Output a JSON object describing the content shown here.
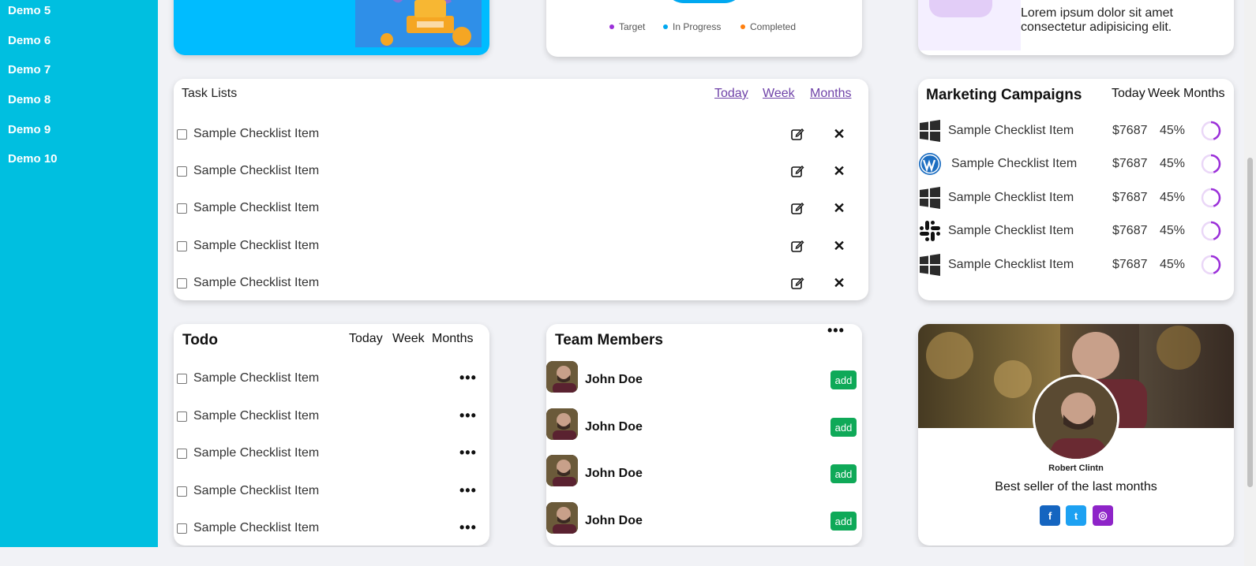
{
  "sidebar": {
    "items": [
      {
        "label": "Demo 5"
      },
      {
        "label": "Demo 6"
      },
      {
        "label": "Demo 7"
      },
      {
        "label": "Demo 8"
      },
      {
        "label": "Demo 9"
      },
      {
        "label": "Demo 10"
      }
    ]
  },
  "status_chart": {
    "legend": [
      "Target",
      "In Progress",
      "Completed"
    ],
    "colors": [
      "#9b30d9",
      "#00a8f0",
      "#ff7f0e"
    ]
  },
  "info_card": {
    "text": "Lorem ipsum dolor sit amet consectetur adipisicing elit."
  },
  "task_lists": {
    "title": "Task Lists",
    "tabs": [
      "Today",
      "Week",
      "Months"
    ],
    "items": [
      {
        "label": "Sample Checklist Item"
      },
      {
        "label": "Sample Checklist Item"
      },
      {
        "label": "Sample Checklist Item"
      },
      {
        "label": "Sample Checklist Item"
      },
      {
        "label": "Sample Checklist Item"
      }
    ],
    "close_glyph": "✕"
  },
  "marketing": {
    "title": "Marketing Campaigns",
    "tabs": [
      "Today",
      "Week",
      "Months"
    ],
    "rows": [
      {
        "logo": "windows-icon",
        "label": "Sample Checklist Item",
        "price": "$7687",
        "percent": "45%",
        "progress": 0.45
      },
      {
        "logo": "wordpress-icon",
        "label": "Sample Checklist Item",
        "price": "$7687",
        "percent": "45%",
        "progress": 0.45
      },
      {
        "logo": "windows-icon",
        "label": "Sample Checklist Item",
        "price": "$7687",
        "percent": "45%",
        "progress": 0.45
      },
      {
        "logo": "slack-icon",
        "label": "Sample Checklist Item",
        "price": "$7687",
        "percent": "45%",
        "progress": 0.45
      },
      {
        "logo": "windows-icon",
        "label": "Sample Checklist Item",
        "price": "$7687",
        "percent": "45%",
        "progress": 0.45
      }
    ],
    "ring_color": "#9b30d9"
  },
  "todo": {
    "title": "Todo",
    "tabs": [
      "Today",
      "Week",
      "Months"
    ],
    "items": [
      {
        "label": "Sample Checklist Item"
      },
      {
        "label": "Sample Checklist Item"
      },
      {
        "label": "Sample Checklist Item"
      },
      {
        "label": "Sample Checklist Item"
      },
      {
        "label": "Sample Checklist Item"
      }
    ],
    "more_glyph": "•••"
  },
  "team": {
    "title": "Team Members",
    "more_glyph": "•••",
    "members": [
      {
        "name": "John Doe",
        "action": "add"
      },
      {
        "name": "John Doe",
        "action": "add"
      },
      {
        "name": "John Doe",
        "action": "add"
      },
      {
        "name": "John Doe",
        "action": "add"
      }
    ],
    "add_color": "#0fa958"
  },
  "profile": {
    "name": "Robert Clintn",
    "bio": "Best seller of the last months",
    "social": [
      {
        "icon": "facebook-icon",
        "glyph": "f",
        "color": "#1565c0"
      },
      {
        "icon": "twitter-icon",
        "glyph": "t",
        "color": "#1da1f2"
      },
      {
        "icon": "dribbble-icon",
        "glyph": "◎",
        "color": "#8e24c8"
      }
    ]
  },
  "colors": {
    "sidebar": "#00bfe0",
    "hero": "#00bcff",
    "link": "#6f42a8"
  }
}
